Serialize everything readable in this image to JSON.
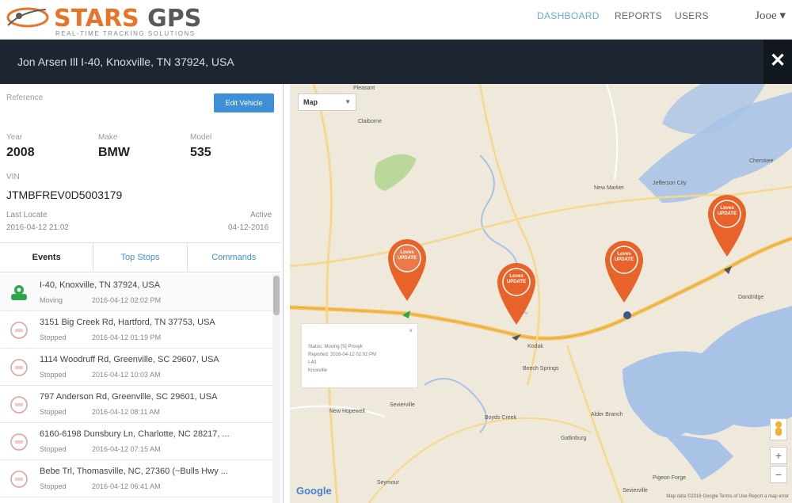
{
  "header": {
    "logo_main": "STARS",
    "logo_accent": "GPS",
    "tagline": "REAL-TIME TRACKING SOLUTIONS",
    "nav": [
      "DASHBOARD",
      "REPORTS",
      "USERS"
    ],
    "active_nav": "DASHBOARD",
    "user": "Jooe ▾"
  },
  "address_bar": {
    "address": "Jon Arsen Ill I-40, Knoxville, TN 37924, USA",
    "close_glyph": "✕"
  },
  "vehicle": {
    "reference_label": "Reference",
    "edit_button": "Edit Vehicle",
    "year_label": "Year",
    "year": "2008",
    "make_label": "Make",
    "make": "BMW",
    "model_label": "Model",
    "model": "535",
    "vin_label": "VIN",
    "vin": "JTMBFREV0D5003179",
    "last_locate_label": "Last Locate",
    "last_locate": "2016-04-12 21:02",
    "active_label": "Active",
    "active": "04-12-2016"
  },
  "tabs": [
    "Events",
    "Top Stops",
    "Commands"
  ],
  "events": [
    {
      "address": "I-40, Knoxville, TN 37924, USA",
      "status": "Moving",
      "time": "2016-04-12 02:02 PM",
      "icon": "car-moving-icon"
    },
    {
      "address": "3151 Big Creek Rd, Hartford, TN 37753, USA",
      "status": "Stopped",
      "time": "2016-04-12 01:19 PM",
      "icon": "stop-icon"
    },
    {
      "address": "1114 Woodruff Rd, Greenville, SC 29607, USA",
      "status": "Stopped",
      "time": "2016-04-12 10:03 AM",
      "icon": "stop-icon"
    },
    {
      "address": "797 Anderson Rd, Greenville, SC 29601, USA",
      "status": "Stopped",
      "time": "2016-04-12 08:11 AM",
      "icon": "stop-icon"
    },
    {
      "address": "6160-6198 Dunsbury Ln, Charlotte, NC 28217, ...",
      "status": "Stopped",
      "time": "2016-04-12 07:15 AM",
      "icon": "stop-icon"
    },
    {
      "address": "Bebe Trl, Thomasville, NC, 27360 (~Bulls Hwy ...",
      "status": "Stopped",
      "time": "2016-04-12 06:41 AM",
      "icon": "stop-icon"
    }
  ],
  "map": {
    "map_type": "Map",
    "pin_label": "Loves UPDATE",
    "info_popup": [
      "Status: Moving [S] Prosyk",
      "Reported: 2016-04-12 02:02 PM",
      "I-40",
      "Knoxville"
    ],
    "towns": [
      "Pleasant",
      "Claiborne",
      "Jefferson City",
      "New Market",
      "Cherokee",
      "Dandridge",
      "Kodak",
      "Beech Springs",
      "Boyds Creek",
      "Pigeon Forge",
      "New Hopewell",
      "Sevierville",
      "Seymour",
      "Gatlinburg",
      "Alder Branch",
      "Sevierville"
    ],
    "attribution": "Map data ©2016 Google   Terms of Use   Report a map error",
    "zoom_in": "+",
    "zoom_out": "−",
    "google": "Google",
    "water_color": "#a9c3e6",
    "road_color": "#f4c15a",
    "pin_color": "#e8632a"
  }
}
